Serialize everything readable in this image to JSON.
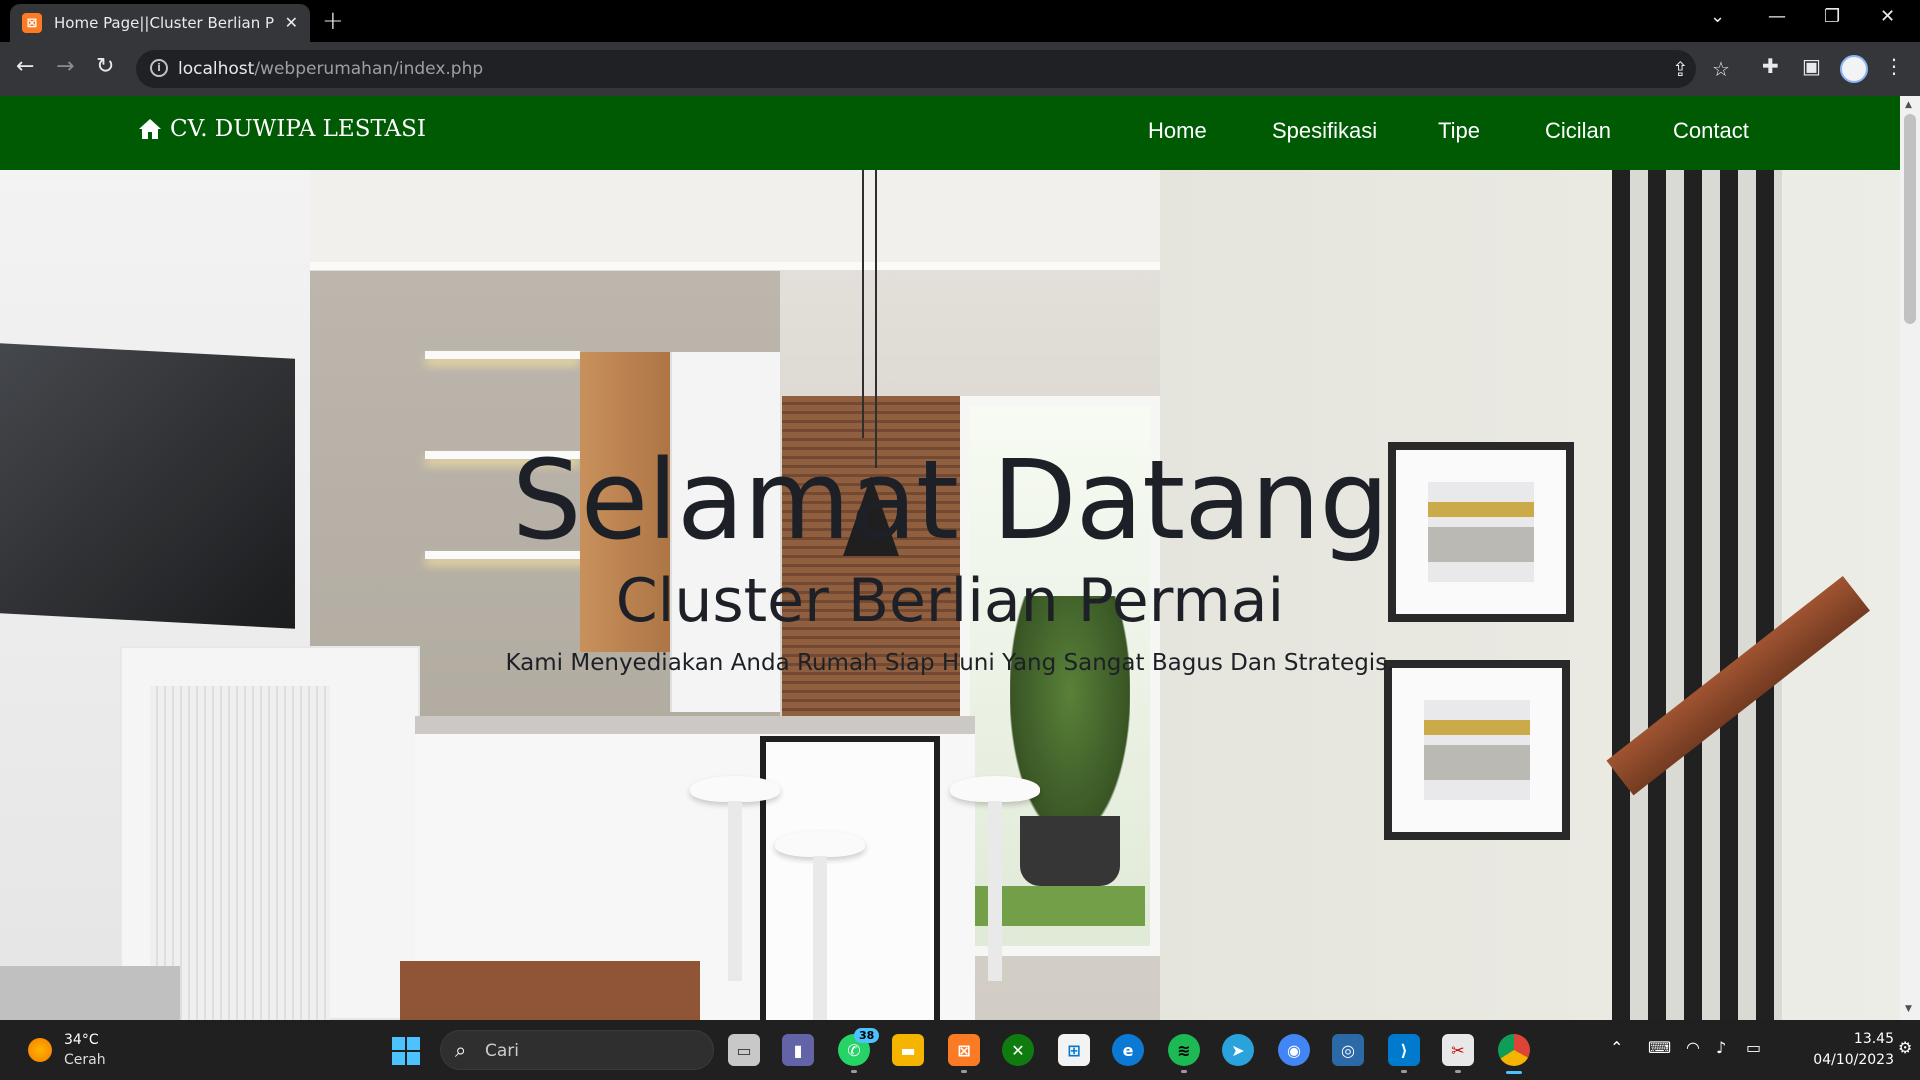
{
  "browser": {
    "tab_title": "Home Page||Cluster Berlian Permai",
    "url_host": "localhost",
    "url_path": "/webperumahan/index.php",
    "icons": [
      "back-arrow-icon",
      "forward-arrow-icon",
      "reload-icon",
      "info-icon",
      "share-icon",
      "star-icon",
      "extensions-icon",
      "side-panel-icon",
      "menu-dots-icon"
    ]
  },
  "site": {
    "brand": "CV. DUWIPA LESTASI",
    "nav": [
      "Home",
      "Spesifikasi",
      "Tipe",
      "Cicilan",
      "Contact"
    ],
    "nav_color": "#005a04"
  },
  "hero": {
    "title": "Selamat Datang",
    "subtitle": "Cluster Berlian Permai",
    "tagline": "Kami Menyediakan Anda Rumah Siap Huni Yang Sangat Bagus Dan Strategis."
  },
  "taskbar": {
    "weather_temp": "34°C",
    "weather_desc": "Cerah",
    "search_placeholder": "Cari",
    "whatsapp_badge": "38",
    "time": "13.45",
    "date": "04/10/2023"
  }
}
